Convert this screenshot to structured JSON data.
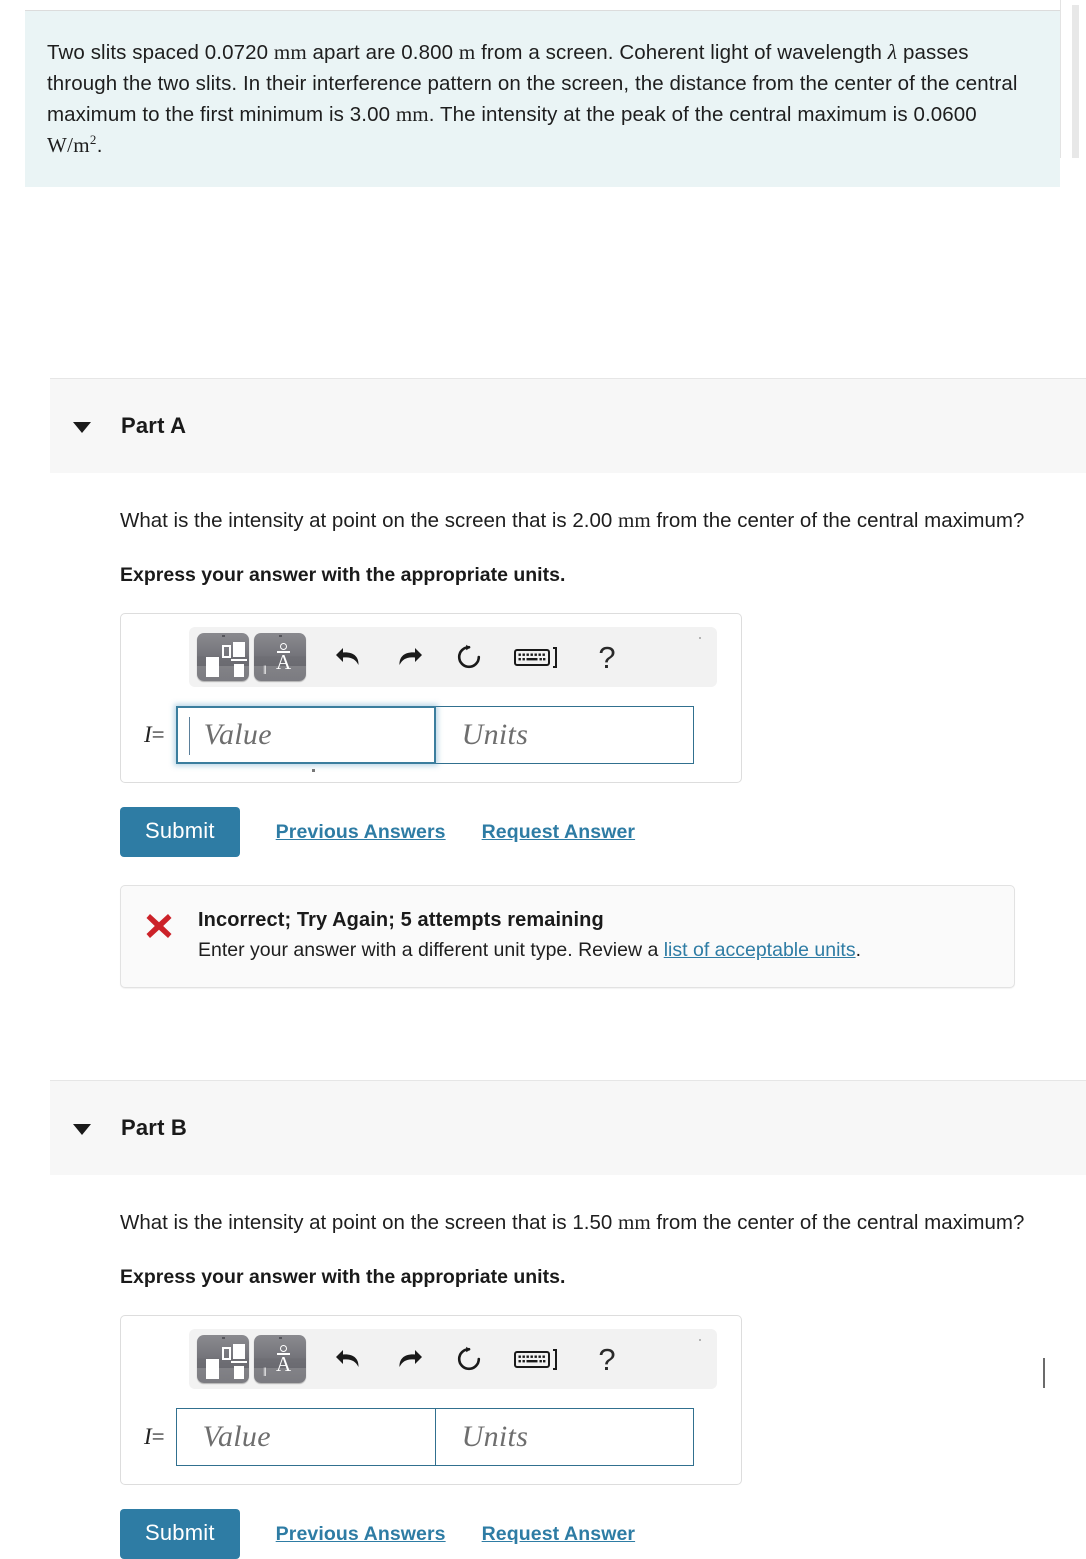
{
  "problem": {
    "line1_a": "Two slits spaced 0.0720",
    "unit_mm_1": "mm",
    "line1_b": " apart are 0.800",
    "unit_m": "m",
    "line1_c": " from a screen. Coherent light of wavelength",
    "lambda": "λ",
    "line2": "passes through the two slits. In their interference pattern on the screen, the distance from the",
    "line3_a": "center of the central maximum to the first minimum is 3.00",
    "unit_mm_2": "mm",
    "line3_b": ". The intensity at the peak of",
    "line4_a": "the central maximum is 0.0600",
    "unit_wm2": "W/m",
    "exp2": "2",
    "line4_b": "."
  },
  "parts": [
    {
      "title": "Part A",
      "question_a": "What is the intensity at point on the screen that is 2.00",
      "question_unit": "mm",
      "question_b": " from the center of the central",
      "question_c": "maximum?",
      "instruction": "Express your answer with the appropriate units.",
      "toolbar": {
        "template_button": "math-template",
        "greek_button": "greek-symbols",
        "undo": "undo",
        "redo": "redo",
        "reset": "reset",
        "keyboard": "keyboard-shortcuts",
        "help": "?"
      },
      "answer": {
        "lhs_symbol": "I",
        "lhs_equals": "=",
        "value_placeholder": "Value",
        "units_placeholder": "Units",
        "value_text": "",
        "units_text": "",
        "focused": true
      },
      "buttons": {
        "submit": "Submit",
        "previous_answers": "Previous Answers",
        "request_answer": "Request Answer"
      },
      "feedback": {
        "icon": "x-mark",
        "title": "Incorrect; Try Again; 5 attempts remaining",
        "body_a": "Enter your answer with a different unit type. Review a ",
        "link": "list of acceptable units",
        "body_b": "."
      }
    },
    {
      "title": "Part B",
      "question_a": "What is the intensity at point on the screen that is 1.50",
      "question_unit": "mm",
      "question_b": " from the center of the central",
      "question_c": "maximum?",
      "instruction": "Express your answer with the appropriate units.",
      "toolbar": {
        "template_button": "math-template",
        "greek_button": "greek-symbols",
        "undo": "undo",
        "redo": "redo",
        "reset": "reset",
        "keyboard": "keyboard-shortcuts",
        "help": "?"
      },
      "answer": {
        "lhs_symbol": "I",
        "lhs_equals": "=",
        "value_placeholder": "Value",
        "units_placeholder": "Units",
        "value_text": "",
        "units_text": "",
        "focused": false
      },
      "buttons": {
        "submit": "Submit",
        "previous_answers": "Previous Answers",
        "request_answer": "Request Answer"
      }
    }
  ],
  "colors": {
    "problem_bg": "#eaf4f5",
    "accent": "#2e7ca4",
    "error": "#cc2229",
    "part_header_bg": "#f7f7f7",
    "field_border": "#31708f"
  }
}
